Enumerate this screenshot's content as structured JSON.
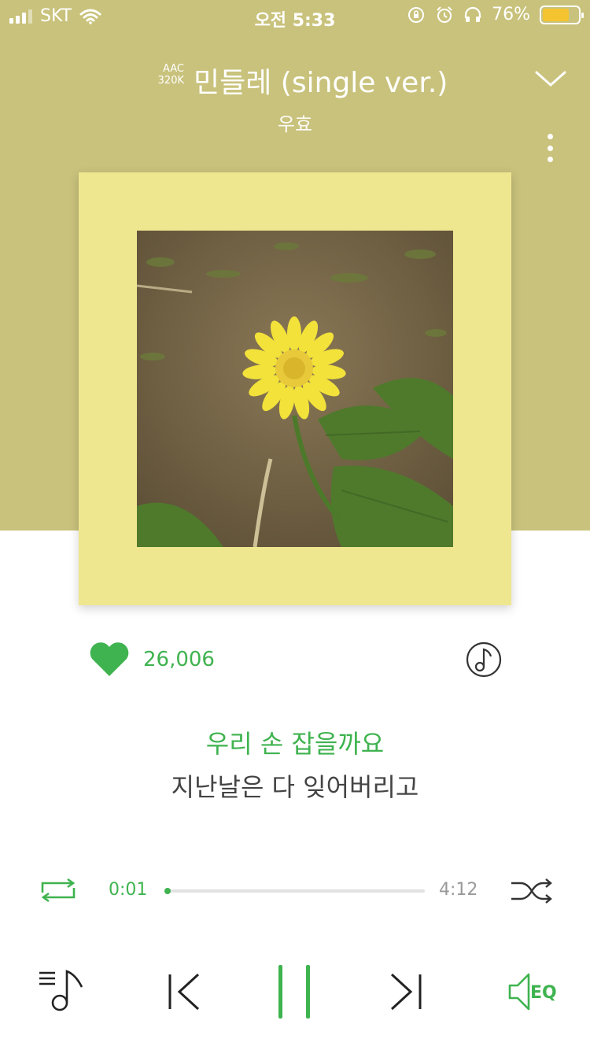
{
  "status": {
    "carrier": "SKT",
    "time": "오전 5:33",
    "battery_text": "76%",
    "battery_level": 0.76
  },
  "header": {
    "quality_codec": "AAC",
    "quality_bitrate": "320K",
    "title": "민들레 (single ver.)",
    "artist": "우효"
  },
  "like": {
    "count": "26,006"
  },
  "lyrics": {
    "current": "우리 손 잡을까요",
    "next": "지난날은 다 잊어버리고"
  },
  "progress": {
    "elapsed": "0:01",
    "total": "4:12",
    "fraction": 0.004
  },
  "colors": {
    "accent": "#3fb34f",
    "header_bg": "#c9c27c",
    "album_frame": "#efe690"
  },
  "icons": {
    "collapse": "chevron-down-icon",
    "more": "more-vertical-icon",
    "like": "heart-icon",
    "note": "music-note-icon",
    "repeat": "repeat-icon",
    "shuffle": "shuffle-icon",
    "playlist": "playlist-icon",
    "prev": "previous-icon",
    "pause": "pause-icon",
    "next": "next-icon",
    "eq": "equalizer-icon"
  }
}
